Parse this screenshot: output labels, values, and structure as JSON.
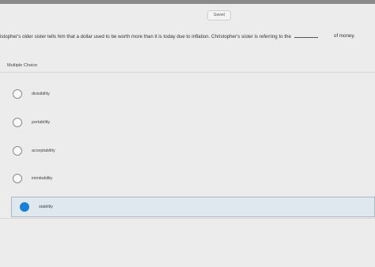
{
  "status": {
    "saved_label": "Saved"
  },
  "question": {
    "text_before": "istopher's older sister tells him that a dollar used to be worth more than it is today due to inflation. Christopher's sister is referring to the",
    "text_after": "of money."
  },
  "answer_section": {
    "type_label": "Multiple Choice",
    "options": [
      {
        "label": "divisibility",
        "selected": false
      },
      {
        "label": "portability",
        "selected": false
      },
      {
        "label": "acceptability",
        "selected": false
      },
      {
        "label": "inimitability",
        "selected": false
      },
      {
        "label": "stability",
        "selected": true
      }
    ]
  },
  "colors": {
    "selected_radio": "#1c7fd2",
    "selected_row_bg": "#dfe8ee",
    "page_bg": "#ececec"
  }
}
